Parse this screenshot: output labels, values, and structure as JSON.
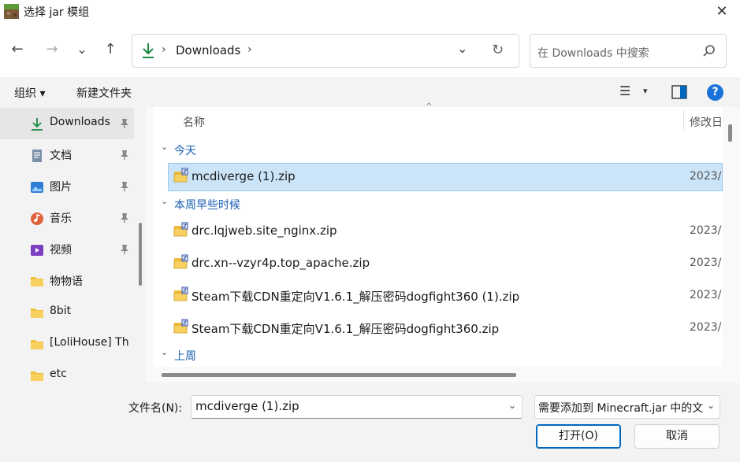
{
  "window": {
    "title": "选择 jar 模组",
    "close_glyph": "✕"
  },
  "nav": {
    "back_glyph": "←",
    "forward_glyph": "→",
    "recent_glyph": "⌄",
    "up_glyph": "↑",
    "address": "Downloads",
    "address_sep": "›",
    "address_chev": "⌄",
    "refresh_glyph": "↻",
    "search_placeholder": "在 Downloads 中搜索"
  },
  "toolbar": {
    "organize": "组织 ▾",
    "new_folder": "新建文件夹",
    "view_glyph": "☰",
    "view_chev": "▾",
    "help_glyph": "?"
  },
  "sidebar": {
    "items": [
      {
        "label": "Downloads",
        "icon": "download-icon",
        "pinned": true,
        "selected": true
      },
      {
        "label": "文档",
        "icon": "document-icon",
        "pinned": true
      },
      {
        "label": "图片",
        "icon": "pictures-icon",
        "pinned": true
      },
      {
        "label": "音乐",
        "icon": "music-icon",
        "pinned": true
      },
      {
        "label": "视频",
        "icon": "video-icon",
        "pinned": true
      },
      {
        "label": "物物语",
        "icon": "folder-icon"
      },
      {
        "label": "8bit",
        "icon": "folder-icon"
      },
      {
        "label": "[LoliHouse] Th",
        "icon": "folder-icon"
      },
      {
        "label": "etc",
        "icon": "folder-icon"
      }
    ],
    "pin_glyph": "📌"
  },
  "list": {
    "columns": {
      "name": "名称",
      "date": "修改日"
    },
    "sort_glyph": "^",
    "groups": [
      {
        "label": "今天",
        "files": [
          {
            "name": "mcdiverge (1).zip",
            "date": "2023/",
            "selected": true
          }
        ]
      },
      {
        "label": "本周早些时候",
        "files": [
          {
            "name": "drc.lqjweb.site_nginx.zip",
            "date": "2023/"
          },
          {
            "name": "drc.xn--vzyr4p.top_apache.zip",
            "date": "2023/"
          },
          {
            "name": "Steam下载CDN重定向V1.6.1_解压密码dogfight360 (1).zip",
            "date": "2023/"
          },
          {
            "name": "Steam下载CDN重定向V1.6.1_解压密码dogfight360.zip",
            "date": "2023/"
          }
        ]
      },
      {
        "label": "上周",
        "files": []
      }
    ],
    "group_chev": "⌄"
  },
  "footer": {
    "filename_label": "文件名(N):",
    "filename_value": "mcdiverge (1).zip",
    "filetype_value": "需要添加到 Minecraft.jar 中的文",
    "chev": "⌄",
    "open_button": "打开(O)",
    "cancel_button": "取消"
  },
  "colors": {
    "accent": "#0067c0",
    "selection": "#cce4f7",
    "group_text": "#1a5fb4",
    "download_green": "#1e8a44"
  }
}
